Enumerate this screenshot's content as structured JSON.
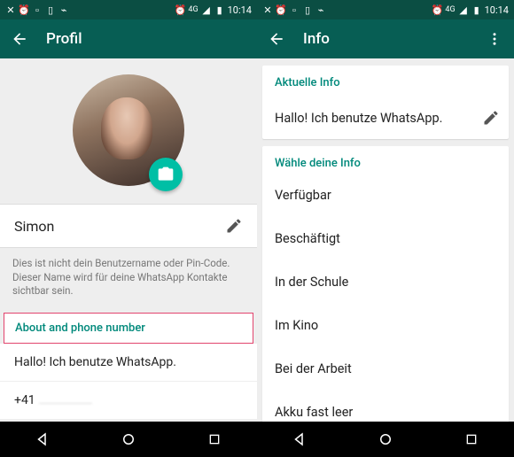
{
  "statusbar": {
    "time": "10:14",
    "net": "4G"
  },
  "left": {
    "title": "Profil",
    "name": "Simon",
    "hint": "Dies ist nicht dein Benutzername oder Pin-Code. Dieser Name wird für deine WhatsApp Kontakte sichtbar sein.",
    "section": "About and phone number",
    "about": "Hallo! Ich benutze WhatsApp.",
    "phone": "+41"
  },
  "right": {
    "title": "Info",
    "current_head": "Aktuelle Info",
    "current_value": "Hallo! Ich benutze WhatsApp.",
    "choose_head": "Wähle deine Info",
    "options": [
      "Verfügbar",
      "Beschäftigt",
      "In der Schule",
      "Im Kino",
      "Bei der Arbeit",
      "Akku fast leer"
    ]
  }
}
